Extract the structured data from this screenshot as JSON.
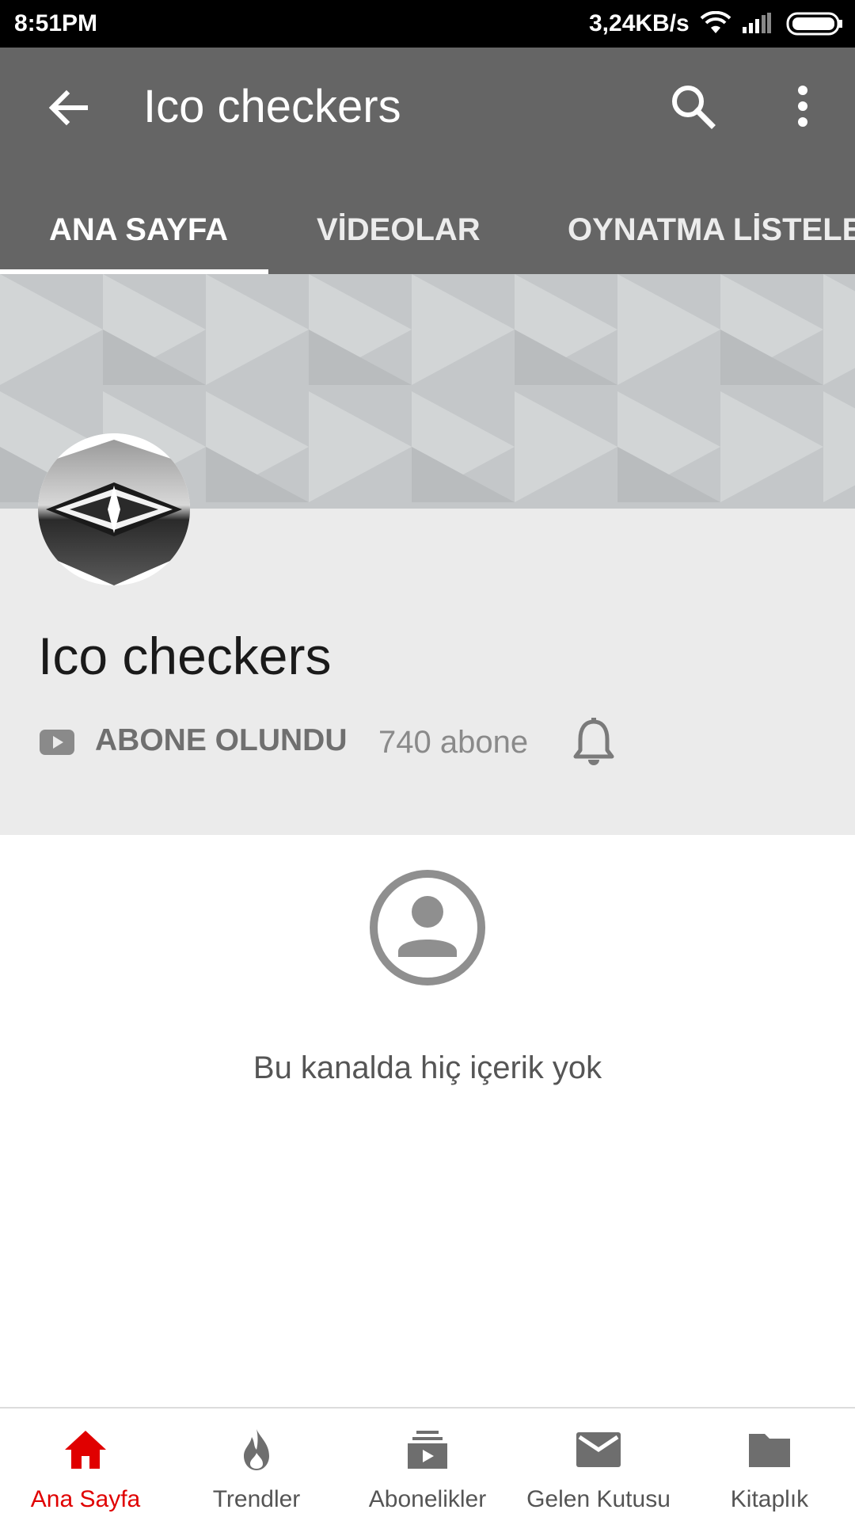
{
  "status_bar": {
    "time": "8:51PM",
    "network_speed": "3,24KB/s"
  },
  "app_bar": {
    "title": "Ico checkers",
    "tabs": [
      {
        "label": "ANA SAYFA",
        "active": true
      },
      {
        "label": "VİDEOLAR",
        "active": false
      },
      {
        "label": "OYNATMA LİSTELERİ",
        "active": false
      }
    ]
  },
  "channel": {
    "name": "Ico checkers",
    "subscribe_label": "ABONE OLUNDU",
    "subscriber_count": "740 abone"
  },
  "empty_state": {
    "message": "Bu kanalda hiç içerik yok"
  },
  "bottom_nav": {
    "items": [
      {
        "label": "Ana Sayfa",
        "icon": "home-icon",
        "active": true
      },
      {
        "label": "Trendler",
        "icon": "flame-icon",
        "active": false
      },
      {
        "label": "Abonelikler",
        "icon": "subscriptions-icon",
        "active": false
      },
      {
        "label": "Gelen Kutusu",
        "icon": "mail-icon",
        "active": false
      },
      {
        "label": "Kitaplık",
        "icon": "folder-icon",
        "active": false
      }
    ]
  },
  "colors": {
    "app_bar": "#656565",
    "active_nav": "#e00000",
    "info_background": "#ebebeb"
  }
}
